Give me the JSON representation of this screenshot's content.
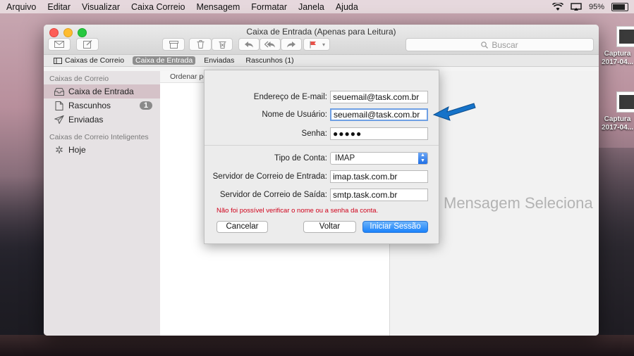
{
  "menubar": {
    "items": [
      "Arquivo",
      "Editar",
      "Visualizar",
      "Caixa Correio",
      "Mensagem",
      "Formatar",
      "Janela",
      "Ajuda"
    ],
    "battery_percent": "95%",
    "battery_level": 0.95
  },
  "window": {
    "title": "Caixa de Entrada (Apenas para Leitura)",
    "search_placeholder": "Buscar"
  },
  "favorites": {
    "mailboxes": "Caixas de Correio",
    "inbox": "Caixa de Entrada",
    "sent": "Enviadas",
    "drafts": "Rascunhos (1)"
  },
  "sidebar": {
    "section1": "Caixas de Correio",
    "items": [
      {
        "label": "Caixa de Entrada",
        "icon": "inbox-icon"
      },
      {
        "label": "Rascunhos",
        "icon": "draft-icon",
        "badge": "1"
      },
      {
        "label": "Enviadas",
        "icon": "sent-icon"
      }
    ],
    "section2": "Caixas de Correio Inteligentes",
    "smart_items": [
      {
        "label": "Hoje",
        "icon": "gear-icon"
      }
    ]
  },
  "list": {
    "sort_label": "Ordenar po"
  },
  "content": {
    "empty_label": "Mensagem Seleciona"
  },
  "sheet": {
    "email_label": "Endereço de E-mail:",
    "email_value": "seuemail@task.com.br",
    "user_label": "Nome de Usuário:",
    "user_value": "seuemail@task.com.br",
    "password_label": "Senha:",
    "password_value": "●●●●●",
    "account_type_label": "Tipo de Conta:",
    "account_type_value": "IMAP",
    "incoming_label": "Servidor de Correio de Entrada:",
    "incoming_value": "imap.task.com.br",
    "outgoing_label": "Servidor de Correio de Saída:",
    "outgoing_value": "smtp.task.com.br",
    "error": "Não foi possível verificar o nome ou a senha da conta.",
    "cancel": "Cancelar",
    "back": "Voltar",
    "sign_in": "Iniciar Sessão"
  },
  "desktop": {
    "files": [
      {
        "line1": "Captura",
        "line2": "2017-04..."
      },
      {
        "line1": "Captura",
        "line2": "2017-04..."
      }
    ]
  },
  "colors": {
    "accent": "#1a82fb",
    "error": "#d0021b",
    "annotation_arrow": "#1673c9"
  }
}
